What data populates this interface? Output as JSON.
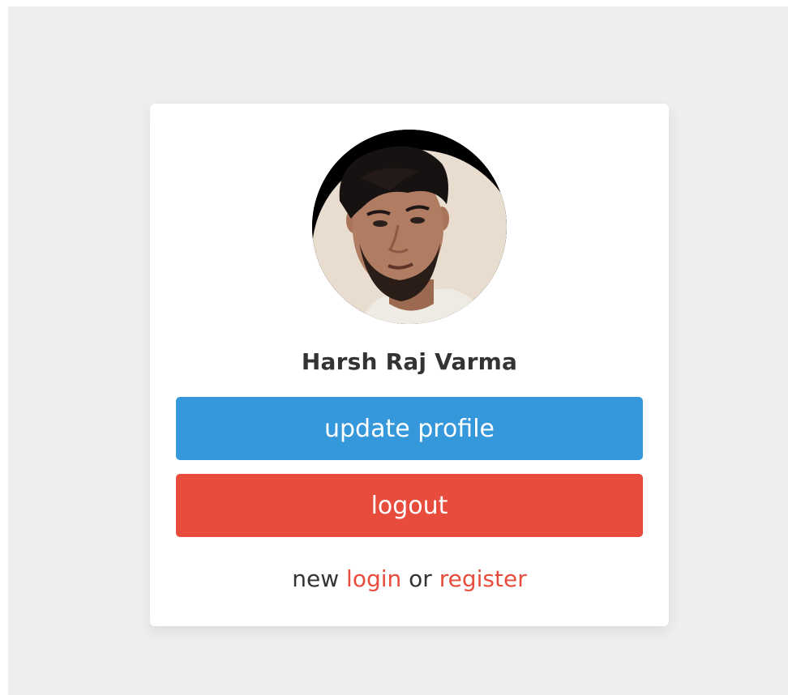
{
  "profile": {
    "name": "Harsh Raj Varma",
    "avatar_icon": "user-photo"
  },
  "actions": {
    "update_label": "update profile",
    "logout_label": "logout"
  },
  "footer": {
    "prefix": "new",
    "login_label": "login",
    "connector": "or",
    "register_label": "register"
  },
  "colors": {
    "background": "#eeeeee",
    "card": "#ffffff",
    "update_button": "#3498db",
    "logout_button": "#e74c3c",
    "link": "#e74c3c",
    "text": "#333333"
  }
}
